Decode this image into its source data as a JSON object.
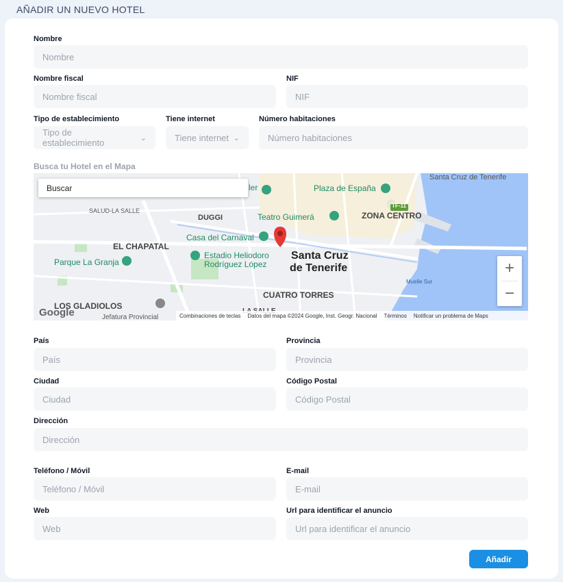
{
  "page": {
    "title": "AÑADIR UN NUEVO HOTEL"
  },
  "form": {
    "nombre": {
      "label": "Nombre",
      "placeholder": "Nombre"
    },
    "nombre_fiscal": {
      "label": "Nombre fiscal",
      "placeholder": "Nombre fiscal"
    },
    "nif": {
      "label": "NIF",
      "placeholder": "NIF"
    },
    "tipo": {
      "label": "Tipo de establecimiento",
      "placeholder": "Tipo de establecimiento"
    },
    "internet": {
      "label": "Tiene internet",
      "placeholder": "Tiene internet"
    },
    "habitaciones": {
      "label": "Número habitaciones",
      "placeholder": "Número habitaciones"
    },
    "pais": {
      "label": "País",
      "placeholder": "País"
    },
    "provincia": {
      "label": "Provincia",
      "placeholder": "Provincia"
    },
    "ciudad": {
      "label": "Ciudad",
      "placeholder": "Ciudad"
    },
    "cp": {
      "label": "Código Postal",
      "placeholder": "Código Postal"
    },
    "direccion": {
      "label": "Dirección",
      "placeholder": "Dirección"
    },
    "telefono": {
      "label": "Teléfono / Móvil",
      "placeholder": "Teléfono / Móvil"
    },
    "email": {
      "label": "E-mail",
      "placeholder": "E-mail"
    },
    "web": {
      "label": "Web",
      "placeholder": "Web"
    },
    "url": {
      "label": "Url para identificar el anuncio",
      "placeholder": "Url para identificar el anuncio"
    },
    "submit_label": "Añadir"
  },
  "map": {
    "title": "Busca tu Hotel en el Mapa",
    "search_placeholder": "Buscar",
    "zoom_in": "+",
    "zoom_out": "−",
    "logo": "Google",
    "attribution": {
      "shortcuts": "Combinaciones de teclas",
      "data": "Datos del mapa ©2024 Google, Inst. Geogr. Nacional",
      "terms": "Términos",
      "report": "Notificar un problema de Maps"
    },
    "labels": {
      "santa_cruz_top": "Santa Cruz de Tenerife",
      "plaza_espana": "Plaza de España",
      "salud": "SALUD-LA SALLE",
      "duggi": "DUGGI",
      "teatro": "Teatro Guimerá",
      "zona_centro": "ZONA CENTRO",
      "el_chapatal": "EL CHAPATAL",
      "carnaval": "Casa del Carnaval",
      "parque": "Parque La Granja",
      "estadio1": "Estadio Heliodoro",
      "estadio2": "Rodríguez López",
      "scruz1": "Santa Cruz",
      "scruz2": "de Tenerife",
      "muelle": "Muelle Sur",
      "gladiolos": "LOS GLADIOLOS",
      "cuatro_torres": "CUATRO TORRES",
      "la_salle": "LA SALLE",
      "jefatura": "Jefatura Provincial",
      "tf11": "TF-11",
      "ler": "ler"
    },
    "colors": {
      "water": "#a0c4f7",
      "park": "#c7e6c3",
      "pin": "#e53935",
      "poi": "#34a37e"
    }
  }
}
